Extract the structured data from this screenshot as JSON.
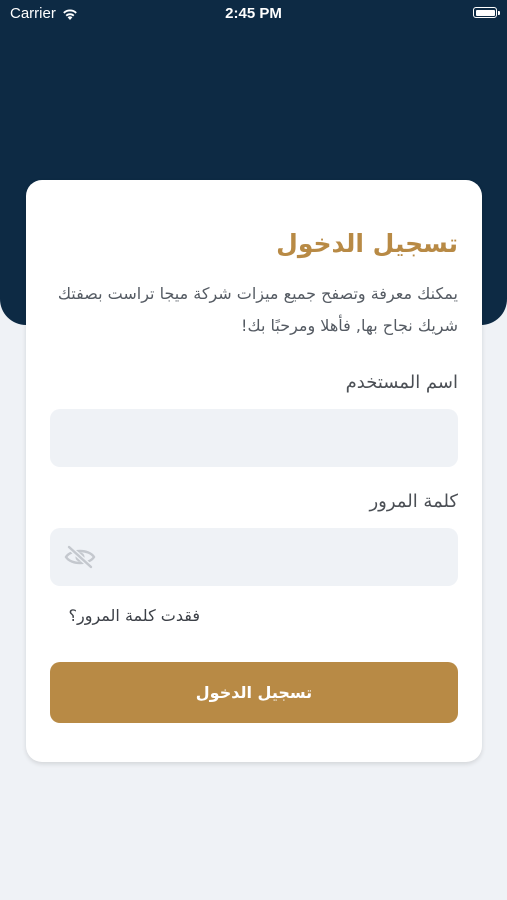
{
  "status_bar": {
    "carrier": "Carrier",
    "time": "2:45 PM"
  },
  "login": {
    "title": "تسجيل الدخول",
    "description": "يمكنك معرفة وتصفح جميع ميزات شركة ميجا تراست بصفتك شريك نجاح بها, فأهلا ومرحبًا بك!",
    "username_label": "اسم المستخدم",
    "username_value": "",
    "password_label": "كلمة المرور",
    "password_value": "",
    "forgot_password": "فقدت كلمة المرور؟",
    "submit_label": "تسجيل الدخول"
  },
  "icons": {
    "wifi": "wifi-icon",
    "battery": "battery-icon",
    "password_visibility": "eye-off-icon"
  },
  "colors": {
    "header_background": "#0d2a44",
    "accent": "#b88a45",
    "page_background": "#eff2f6",
    "field_background": "#eff2f6"
  }
}
